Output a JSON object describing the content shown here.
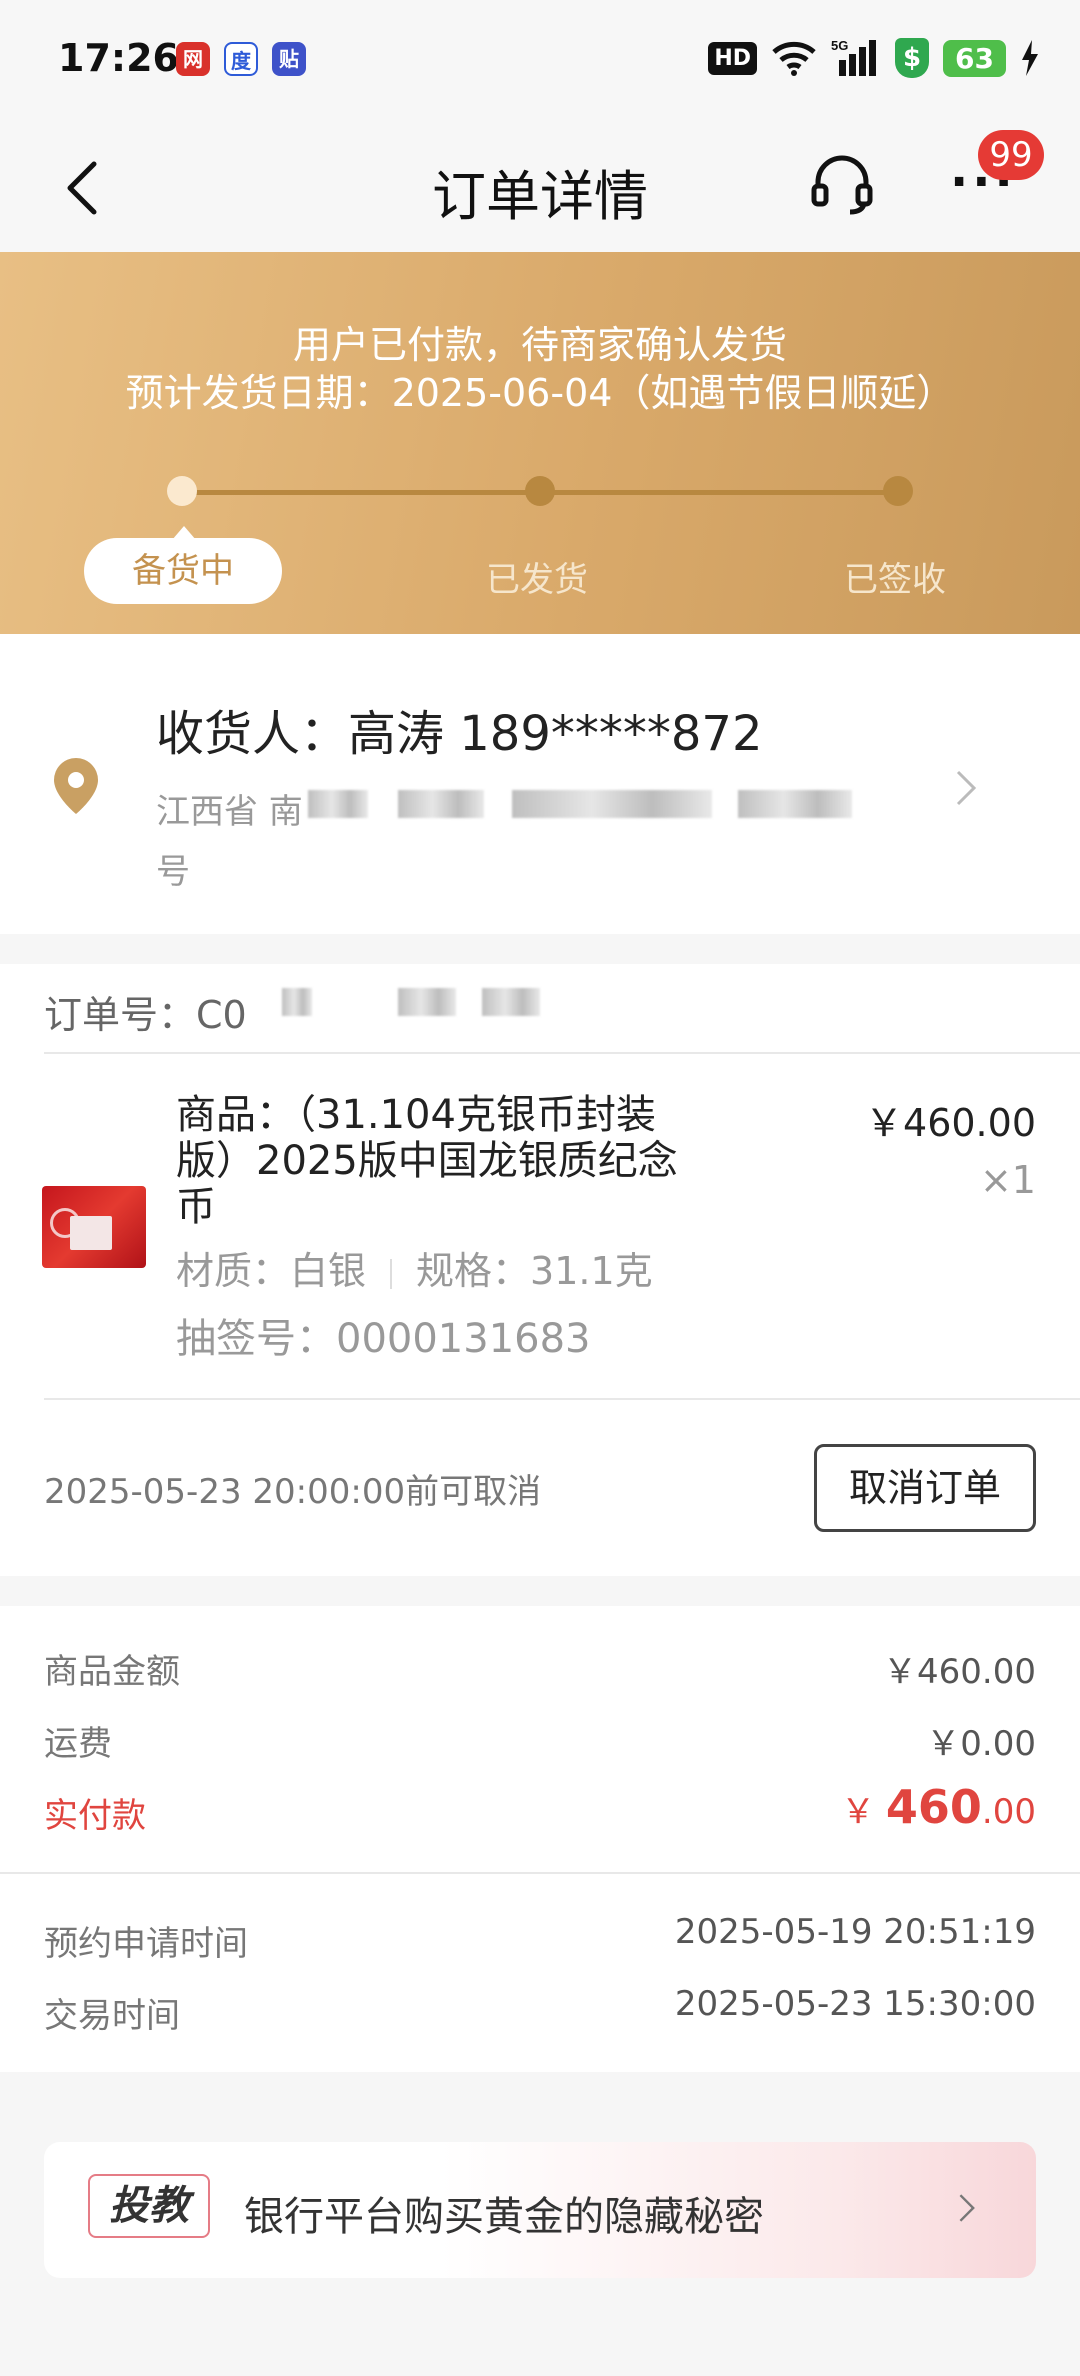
{
  "status_bar": {
    "time": "17:26",
    "hd": "HD",
    "signal": "5G",
    "battery": "63",
    "app_icons": [
      "news-app-icon",
      "baidu-app-icon",
      "tieba-app-icon"
    ]
  },
  "nav": {
    "title": "订单详情",
    "badge_count": "99"
  },
  "banner": {
    "line1": "用户已付款，待商家确认发货",
    "line2": "预计发货日期：2025-06-04（如遇节假日顺延）",
    "steps": [
      "备货中",
      "已发货",
      "已签收"
    ],
    "active_step": 0,
    "accent_color": "#d9a96a"
  },
  "address": {
    "receiver": "收货人：高涛 189*****872",
    "line1_prefix": "江西省 南",
    "line2": "号"
  },
  "order": {
    "order_no_prefix": "订单号：C0",
    "product_name": "商品：（31.104克银币封装版）2025版中国龙银质纪念币",
    "price": "￥460.00",
    "qty": "×1",
    "material": "材质：白银",
    "spec": "规格：31.1克",
    "lottery_no": "抽签号：0000131683",
    "cancel_note": "2025-05-23 20:00:00前可取消",
    "cancel_button": "取消订单"
  },
  "amounts": {
    "goods_label": "商品金额",
    "goods_value": "￥460.00",
    "shipping_label": "运费",
    "shipping_value": "￥0.00",
    "paid_label": "实付款",
    "paid_currency": "￥",
    "paid_integer": "460",
    "paid_decimal": ".00",
    "apply_time_label": "预约申请时间",
    "apply_time_value": "2025-05-19 20:51:19",
    "trade_time_label": "交易时间",
    "trade_time_value": "2025-05-23 15:30:00",
    "paid_color": "#e0453f"
  },
  "promo": {
    "tag": "投教",
    "text": "银行平台购买黄金的隐藏秘密"
  }
}
